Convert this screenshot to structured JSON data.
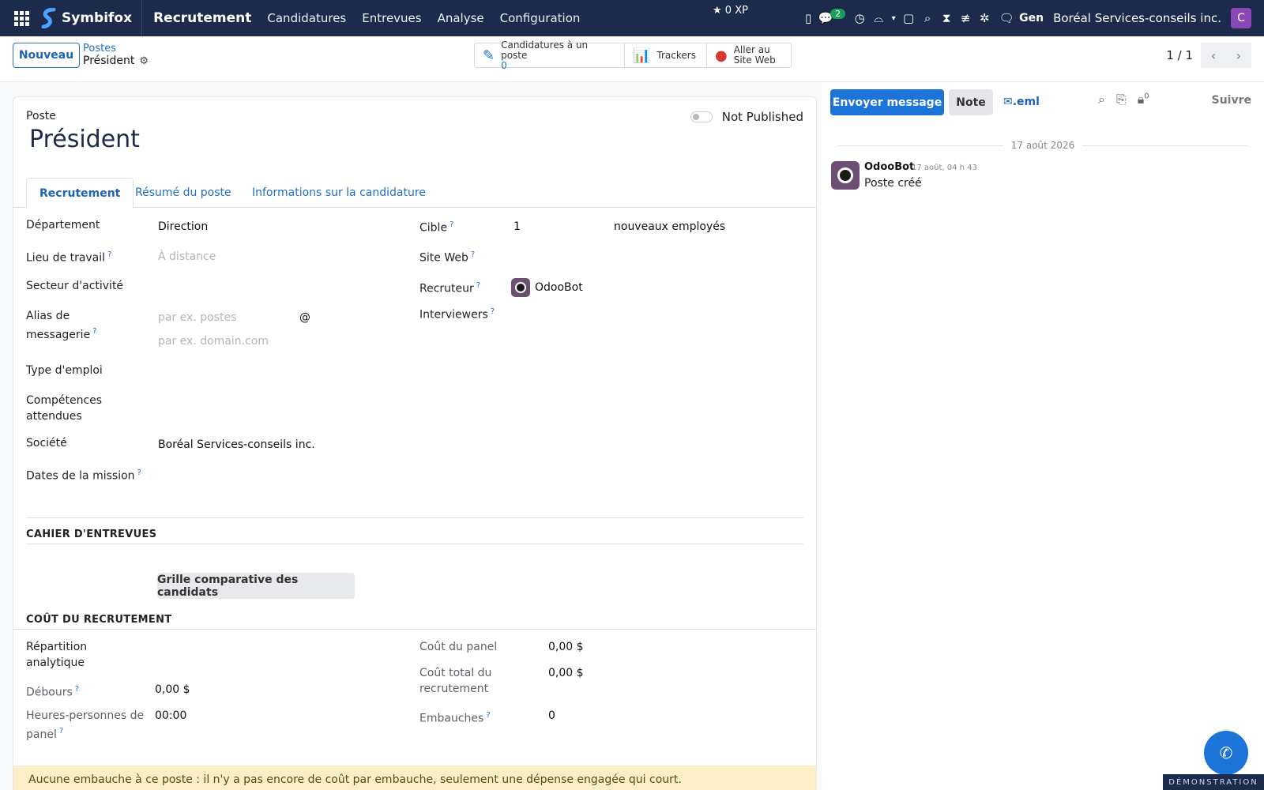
{
  "navbar": {
    "brand": "Symbifox",
    "app_title": "Recrutement",
    "menu": [
      "Candidatures",
      "Entrevues",
      "Analyse",
      "Configuration"
    ],
    "xp": "0 XP",
    "chat_badge": "2",
    "gen_label": "Gen",
    "company": "Boréal Services-conseils inc.",
    "user_initial": "C",
    "icons": [
      "apps-grid-icon",
      "phone-icon",
      "chat-icon",
      "clock-icon",
      "inbox-icon",
      "caret-down-icon",
      "note-icon",
      "search-icon",
      "hourglass-icon",
      "sliders-icon",
      "bug-icon",
      "comment-icon"
    ]
  },
  "control": {
    "new_button": "Nouveau",
    "breadcrumb_parent": "Postes",
    "breadcrumb_current": "Président",
    "smart_buttons": {
      "applications_label": "Candidatures à un poste",
      "applications_count": "0",
      "trackers_label": "Trackers",
      "website_line1": "Aller au",
      "website_line2": "Site Web"
    },
    "pager": "1 / 1"
  },
  "form": {
    "poste_label": "Poste",
    "title": "Président",
    "publish_status": "Not Published",
    "tabs": [
      "Recrutement",
      "Résumé du poste",
      "Informations sur la candidature"
    ],
    "left_fields": {
      "departement_label": "Département",
      "departement_value": "Direction",
      "lieu_label": "Lieu de travail",
      "lieu_placeholder": "À distance",
      "secteur_label": "Secteur d'activité",
      "alias_label_1": "Alias de",
      "alias_label_2": "messagerie",
      "alias_placeholder": "par ex. postes",
      "alias_at": "@",
      "domain_placeholder": "par ex. domain.com",
      "type_label": "Type d'emploi",
      "competences_label_1": "Compétences",
      "competences_label_2": "attendues",
      "societe_label": "Société",
      "societe_value": "Boréal Services-conseils inc.",
      "dates_label": "Dates de la mission"
    },
    "right_fields": {
      "cible_label": "Cible",
      "cible_value": "1",
      "cible_suffix": "nouveaux employés",
      "site_label": "Site Web",
      "recruteur_label": "Recruteur",
      "recruteur_value": "OdooBot",
      "interviewers_label": "Interviewers"
    },
    "interview_section": {
      "title": "CAHIER D'ENTREVUES",
      "button": "Grille comparative des candidats"
    },
    "cost_section": {
      "title": "COÛT DU RECRUTEMENT",
      "repartition_label_1": "Répartition",
      "repartition_label_2": "analytique",
      "debours_label": "Débours",
      "debours_value": "0,00 $",
      "heures_label_1": "Heures-personnes de",
      "heures_label_2": "panel",
      "heures_value": "00:00",
      "cout_panel_label": "Coût du panel",
      "cout_panel_value": "0,00 $",
      "cout_total_label_1": "Coût total du",
      "cout_total_label_2": "recrutement",
      "cout_total_value": "0,00 $",
      "embauches_label": "Embauches",
      "embauches_value": "0"
    },
    "warning": "Aucune embauche à ce poste : il n'y a pas encore de coût par embauche, seulement une dépense engagée qui court."
  },
  "chatter": {
    "send_button": "Envoyer message",
    "note_button": "Note",
    "eml_label": ".eml",
    "follower_count": "0",
    "follow_label": "Suivre",
    "date_separator": "17 août 2026",
    "message": {
      "author": "OdooBot",
      "time": "17 août, 04 h 43",
      "body": "Poste créé"
    }
  },
  "demo_badge": "DÉMONSTRATION"
}
